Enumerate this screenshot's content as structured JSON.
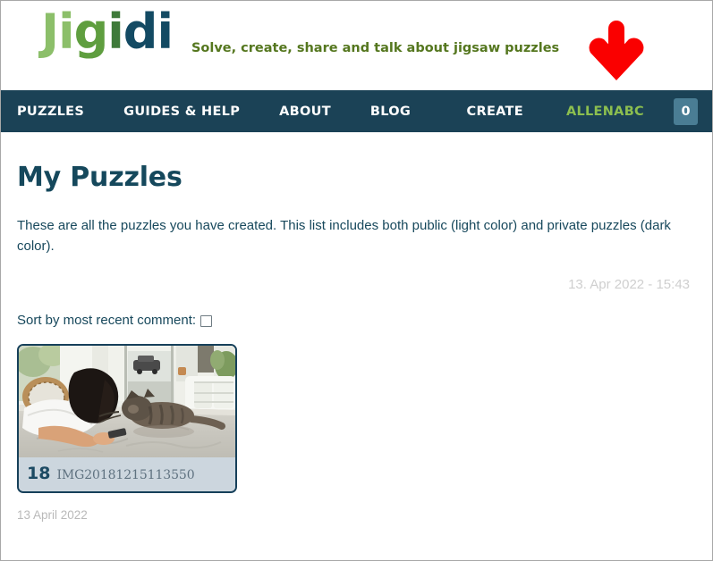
{
  "header": {
    "logo_letters": [
      "J",
      "i",
      "g",
      "i",
      "d",
      "i"
    ],
    "logo_text": "Jigidi",
    "tagline": "Solve, create, share and talk about jigsaw puzzles",
    "annotation_icon": "red-down-arrow"
  },
  "nav": {
    "left_items": [
      {
        "label": "PUZZLES",
        "name": "nav-puzzles"
      },
      {
        "label": "GUIDES & HELP",
        "name": "nav-guides-help"
      },
      {
        "label": "ABOUT",
        "name": "nav-about"
      },
      {
        "label": "BLOG",
        "name": "nav-blog"
      }
    ],
    "create_label": "CREATE",
    "user_label": "ALLENABC",
    "badge_count": "0"
  },
  "main": {
    "page_title": "My Puzzles",
    "description": "These are all the puzzles you have created. This list includes both public (light color) and private puzzles (dark color).",
    "timestamp": "13. Apr 2022 - 15:43",
    "sort_label": "Sort by most recent comment:",
    "sort_checked": false,
    "footer_date": "13 April 2022"
  },
  "puzzles": [
    {
      "piece_count": "18",
      "name": "IMG20181215113550",
      "thumbnail_alt": "person lying on marble table next to a tabby cat"
    }
  ],
  "colors": {
    "nav_background": "#1b4256",
    "user_accent": "#8cbf4f",
    "badge_background": "#4a7d94",
    "heading": "#15485c",
    "logo_light_green": "#8cbf6a",
    "logo_mid_green": "#5f9e3f",
    "logo_dark_green": "#3f7a3a",
    "logo_navy": "#134a63",
    "tagline": "#55771f",
    "card_border": "#16405a",
    "card_caption_bg": "#ccd6de",
    "annotation_red": "#fa0000",
    "muted_text": "#cfcfcf"
  }
}
